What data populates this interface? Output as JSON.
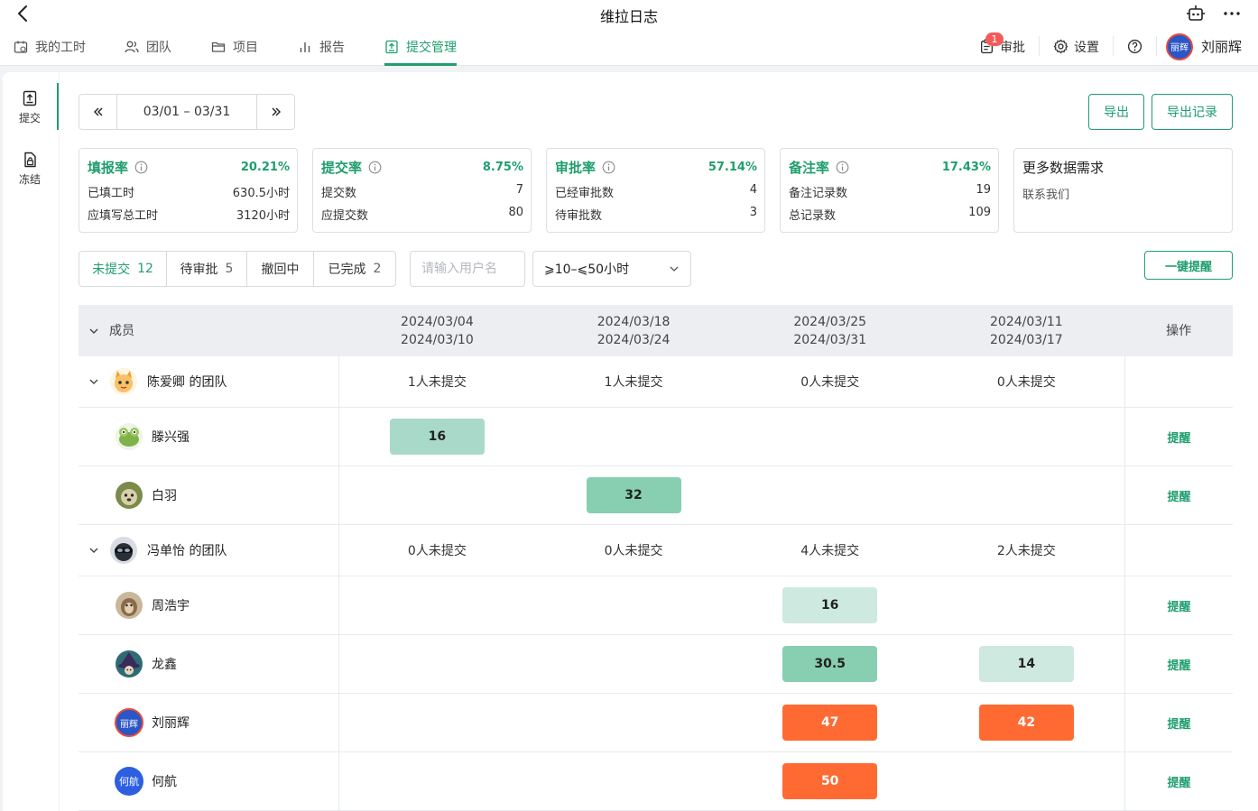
{
  "app": {
    "title": "维拉日志"
  },
  "nav": {
    "tabs": [
      {
        "label": "我的工时",
        "icon": "calendar-icon"
      },
      {
        "label": "团队",
        "icon": "people-icon"
      },
      {
        "label": "项目",
        "icon": "folder-icon"
      },
      {
        "label": "报告",
        "icon": "bar-chart-icon"
      },
      {
        "label": "提交管理",
        "icon": "submit-doc-icon",
        "active": true
      }
    ],
    "approval": {
      "label": "审批",
      "badge": "1"
    },
    "settings_label": "设置",
    "user": {
      "name": "刘丽辉",
      "avatar_text": "丽辉"
    }
  },
  "rail": {
    "items": [
      {
        "label": "提交",
        "active": true
      },
      {
        "label": "冻结"
      }
    ]
  },
  "toolbar": {
    "date_range": "03/01 – 03/31",
    "export_label": "导出",
    "export_log_label": "导出记录"
  },
  "stats": [
    {
      "title": "填报率",
      "rate": "20.21%",
      "rows": [
        {
          "label": "已填工时",
          "value": "630.5小时"
        },
        {
          "label": "应填写总工时",
          "value": "3120小时"
        }
      ]
    },
    {
      "title": "提交率",
      "rate": "8.75%",
      "rows": [
        {
          "label": "提交数",
          "value": "7"
        },
        {
          "label": "应提交数",
          "value": "80"
        }
      ]
    },
    {
      "title": "审批率",
      "rate": "57.14%",
      "rows": [
        {
          "label": "已经审批数",
          "value": "4"
        },
        {
          "label": "待审批数",
          "value": "3"
        }
      ]
    },
    {
      "title": "备注率",
      "rate": "17.43%",
      "rows": [
        {
          "label": "备注记录数",
          "value": "19"
        },
        {
          "label": "总记录数",
          "value": "109"
        }
      ]
    }
  ],
  "more_card": {
    "title": "更多数据需求",
    "link": "联系我们"
  },
  "filters": [
    {
      "label": "未提交",
      "count": "12",
      "active": true
    },
    {
      "label": "待审批",
      "count": "5"
    },
    {
      "label": "撤回中",
      "count": ""
    },
    {
      "label": "已完成",
      "count": "2"
    }
  ],
  "search": {
    "placeholder": "请输入用户名"
  },
  "hours_filter": {
    "value": "⩾10–⩽50小时"
  },
  "remind_all_label": "一键提醒",
  "table": {
    "member_header": "成员",
    "action_header": "操作",
    "weeks": [
      {
        "start": "2024/03/04",
        "end": "2024/03/10"
      },
      {
        "start": "2024/03/18",
        "end": "2024/03/24"
      },
      {
        "start": "2024/03/25",
        "end": "2024/03/31"
      },
      {
        "start": "2024/03/11",
        "end": "2024/03/17"
      }
    ],
    "remind_label": "提醒",
    "teams": [
      {
        "name": "陈爱卿 的团队",
        "pending": [
          "1人未提交",
          "1人未提交",
          "0人未提交",
          "0人未提交"
        ],
        "members": [
          {
            "name": "滕兴强",
            "hours": [
              "16",
              "",
              "",
              ""
            ]
          },
          {
            "name": "白羽",
            "hours": [
              "",
              "32",
              "",
              ""
            ]
          }
        ]
      },
      {
        "name": "冯单怡 的团队",
        "pending": [
          "0人未提交",
          "0人未提交",
          "4人未提交",
          "2人未提交"
        ],
        "members": [
          {
            "name": "周浩宇",
            "hours": [
              "",
              "",
              "16",
              ""
            ]
          },
          {
            "name": "龙鑫",
            "hours": [
              "",
              "",
              "30.5",
              "14"
            ]
          },
          {
            "name": "刘丽辉",
            "avatar_text": "丽辉",
            "hours": [
              "",
              "",
              "47",
              "42"
            ]
          },
          {
            "name": "何航",
            "avatar_text": "何航",
            "hours": [
              "",
              "",
              "50",
              ""
            ]
          }
        ]
      }
    ]
  }
}
